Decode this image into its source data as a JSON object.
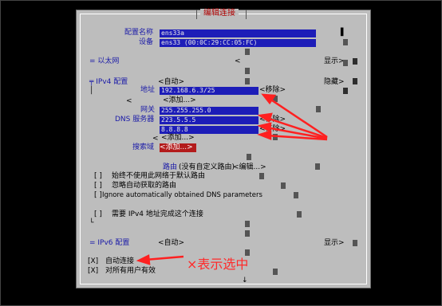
{
  "dialog": {
    "title": "编辑连接",
    "profile_name_label": "配置名称",
    "profile_name_value": "ens33a",
    "device_label": "设备",
    "device_value": "ens33 (00:0C:29:CC:05:FC)",
    "ethernet_label": "= 以太网",
    "show_label": "显示",
    "ipv4_label": "╤ IPv4 配置",
    "ipv4_mode": "<自动>",
    "hide_label": "隐藏",
    "address_label": "地址",
    "address_value": "192.168.6.3/25",
    "remove_label": "<移除>",
    "add_label": "<添加...>",
    "gateway_label": "网关",
    "gateway_value": "255.255.255.0",
    "dns_label": "DNS 服务器",
    "dns1_value": "223.5.5.5",
    "dns2_value": "8.8.8.8",
    "search_domain_label": "搜索域",
    "search_add_label": "<添加...>",
    "routing_label": "路由",
    "routing_value": "(没有自定义路由)",
    "routing_edit": "<编辑...>",
    "never_default_label": "始终不使用此网络于默认路由",
    "ignore_routes_label": "忽略自动获取的路由",
    "ignore_dns_label": "Ignore automatically obtained DNS parameters",
    "require_ipv4_label": "需要 IPv4 地址完成这个连接",
    "ipv6_label": "= IPv6 配置",
    "ipv6_mode": "<自动>",
    "ipv6_show_label": "显示",
    "auto_connect_label": "自动连接",
    "all_users_label": "对所有用户有效",
    "checkbox_checked": "[X]",
    "checkbox_unchecked": "[ ]",
    "arrow_down": "↓"
  },
  "annotation": {
    "text": "×表示选中",
    "color": "#ff2a2a"
  }
}
